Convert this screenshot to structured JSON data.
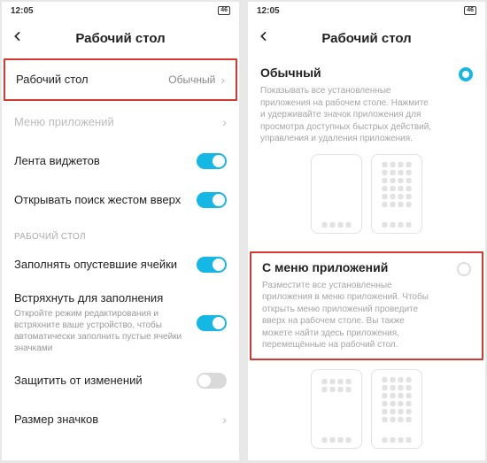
{
  "statusbar": {
    "time": "12:05",
    "net": "46"
  },
  "left": {
    "title": "Рабочий стол",
    "rows": {
      "desktop": {
        "label": "Рабочий стол",
        "value": "Обычный"
      },
      "appMenu": {
        "label": "Меню приложений"
      },
      "widgets": {
        "label": "Лента виджетов"
      },
      "search": {
        "label": "Открывать поиск жестом вверх"
      }
    },
    "section": "РАБОЧИЙ СТОЛ",
    "rows2": {
      "fill": {
        "label": "Заполнять опустевшие ячейки"
      },
      "shake": {
        "label": "Встряхнуть для заполнения",
        "sub": "Откройте режим редактирования и встряхните ваше устройство, чтобы автоматически заполнить пустые ячейки значками"
      },
      "lock": {
        "label": "Защитить от изменений"
      },
      "size": {
        "label": "Размер значков"
      }
    }
  },
  "right": {
    "title": "Рабочий стол",
    "opt1": {
      "title": "Обычный",
      "desc": "Показывать все установленные приложения на рабочем столе. Нажмите и удерживайте значок приложения для просмотра доступных быстрых действий, управления и удаления приложения."
    },
    "opt2": {
      "title": "С меню приложений",
      "desc": "Разместите все установленные приложения в меню приложений. Чтобы открыть меню приложений проведите вверх на рабочем столе. Вы также можете найти здесь приложения, перемещённые на рабочий стол."
    }
  }
}
